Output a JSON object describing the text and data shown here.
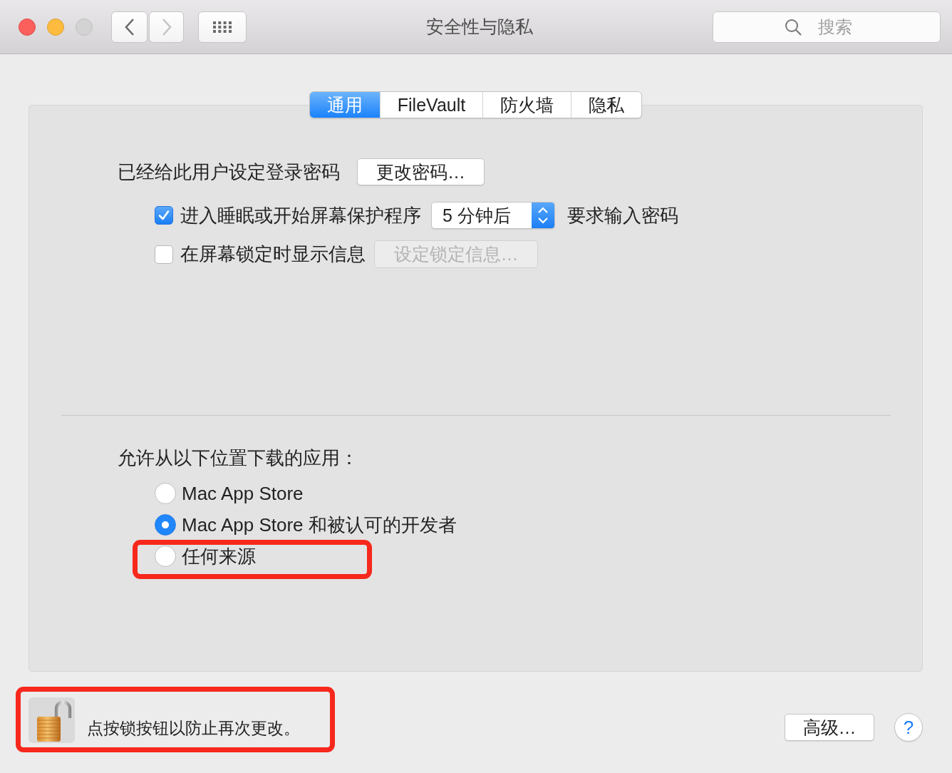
{
  "window": {
    "title": "安全性与隐私",
    "controls": [
      {
        "kind": "close",
        "disabled": false
      },
      {
        "kind": "minimize",
        "disabled": false
      },
      {
        "kind": "zoom",
        "disabled": true
      }
    ]
  },
  "toolbar": {
    "back": {
      "disabled": false
    },
    "forward": {
      "disabled": true
    },
    "search": {
      "placeholder": "搜索"
    }
  },
  "tabs": [
    {
      "label": "通用",
      "selected": true
    },
    {
      "label": "FileVault",
      "selected": false
    },
    {
      "label": "防火墙",
      "selected": false
    },
    {
      "label": "隐私",
      "selected": false
    }
  ],
  "general": {
    "password": {
      "label": "已经给此用户设定登录密码",
      "button": "更改密码…"
    },
    "require_password": {
      "checked": true,
      "label": "进入睡眠或开始屏幕保护程序",
      "delay": "5 分钟后",
      "suffix": "要求输入密码"
    },
    "lock_message": {
      "checked": false,
      "label": "在屏幕锁定时显示信息",
      "button": "设定锁定信息…",
      "button_disabled": true
    }
  },
  "downloads": {
    "label": "允许从以下位置下载的应用：",
    "options": [
      {
        "label": "Mac App Store",
        "selected": false,
        "highlighted": false
      },
      {
        "label": "Mac App Store 和被认可的开发者",
        "selected": true,
        "highlighted": false
      },
      {
        "label": "任何来源",
        "selected": false,
        "highlighted": true
      }
    ]
  },
  "footer": {
    "locked": false,
    "message": "点按锁按钮以防止再次更改。",
    "highlighted": true,
    "advanced_button": "高级…",
    "help_button": "?"
  }
}
